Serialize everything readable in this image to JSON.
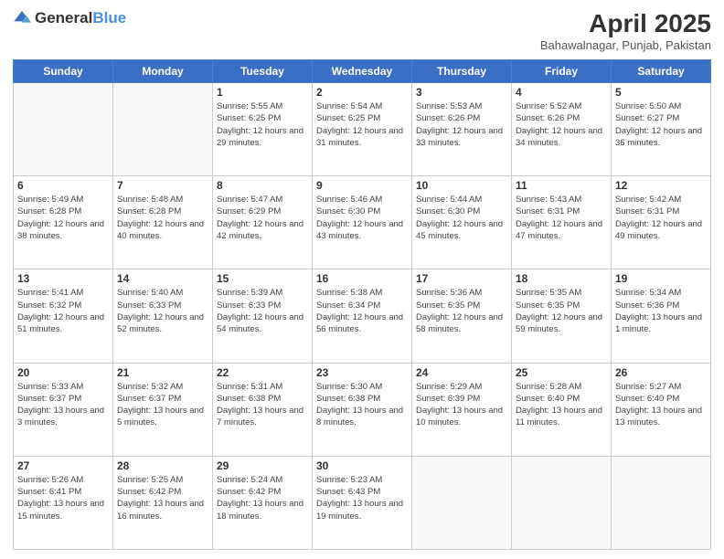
{
  "header": {
    "logo_general": "General",
    "logo_blue": "Blue",
    "title": "April 2025",
    "location": "Bahawalnagar, Punjab, Pakistan"
  },
  "days_of_week": [
    "Sunday",
    "Monday",
    "Tuesday",
    "Wednesday",
    "Thursday",
    "Friday",
    "Saturday"
  ],
  "weeks": [
    [
      {
        "day": "",
        "info": ""
      },
      {
        "day": "",
        "info": ""
      },
      {
        "day": "1",
        "info": "Sunrise: 5:55 AM\nSunset: 6:25 PM\nDaylight: 12 hours and 29 minutes."
      },
      {
        "day": "2",
        "info": "Sunrise: 5:54 AM\nSunset: 6:25 PM\nDaylight: 12 hours and 31 minutes."
      },
      {
        "day": "3",
        "info": "Sunrise: 5:53 AM\nSunset: 6:26 PM\nDaylight: 12 hours and 33 minutes."
      },
      {
        "day": "4",
        "info": "Sunrise: 5:52 AM\nSunset: 6:26 PM\nDaylight: 12 hours and 34 minutes."
      },
      {
        "day": "5",
        "info": "Sunrise: 5:50 AM\nSunset: 6:27 PM\nDaylight: 12 hours and 36 minutes."
      }
    ],
    [
      {
        "day": "6",
        "info": "Sunrise: 5:49 AM\nSunset: 6:28 PM\nDaylight: 12 hours and 38 minutes."
      },
      {
        "day": "7",
        "info": "Sunrise: 5:48 AM\nSunset: 6:28 PM\nDaylight: 12 hours and 40 minutes."
      },
      {
        "day": "8",
        "info": "Sunrise: 5:47 AM\nSunset: 6:29 PM\nDaylight: 12 hours and 42 minutes."
      },
      {
        "day": "9",
        "info": "Sunrise: 5:46 AM\nSunset: 6:30 PM\nDaylight: 12 hours and 43 minutes."
      },
      {
        "day": "10",
        "info": "Sunrise: 5:44 AM\nSunset: 6:30 PM\nDaylight: 12 hours and 45 minutes."
      },
      {
        "day": "11",
        "info": "Sunrise: 5:43 AM\nSunset: 6:31 PM\nDaylight: 12 hours and 47 minutes."
      },
      {
        "day": "12",
        "info": "Sunrise: 5:42 AM\nSunset: 6:31 PM\nDaylight: 12 hours and 49 minutes."
      }
    ],
    [
      {
        "day": "13",
        "info": "Sunrise: 5:41 AM\nSunset: 6:32 PM\nDaylight: 12 hours and 51 minutes."
      },
      {
        "day": "14",
        "info": "Sunrise: 5:40 AM\nSunset: 6:33 PM\nDaylight: 12 hours and 52 minutes."
      },
      {
        "day": "15",
        "info": "Sunrise: 5:39 AM\nSunset: 6:33 PM\nDaylight: 12 hours and 54 minutes."
      },
      {
        "day": "16",
        "info": "Sunrise: 5:38 AM\nSunset: 6:34 PM\nDaylight: 12 hours and 56 minutes."
      },
      {
        "day": "17",
        "info": "Sunrise: 5:36 AM\nSunset: 6:35 PM\nDaylight: 12 hours and 58 minutes."
      },
      {
        "day": "18",
        "info": "Sunrise: 5:35 AM\nSunset: 6:35 PM\nDaylight: 12 hours and 59 minutes."
      },
      {
        "day": "19",
        "info": "Sunrise: 5:34 AM\nSunset: 6:36 PM\nDaylight: 13 hours and 1 minute."
      }
    ],
    [
      {
        "day": "20",
        "info": "Sunrise: 5:33 AM\nSunset: 6:37 PM\nDaylight: 13 hours and 3 minutes."
      },
      {
        "day": "21",
        "info": "Sunrise: 5:32 AM\nSunset: 6:37 PM\nDaylight: 13 hours and 5 minutes."
      },
      {
        "day": "22",
        "info": "Sunrise: 5:31 AM\nSunset: 6:38 PM\nDaylight: 13 hours and 7 minutes."
      },
      {
        "day": "23",
        "info": "Sunrise: 5:30 AM\nSunset: 6:38 PM\nDaylight: 13 hours and 8 minutes."
      },
      {
        "day": "24",
        "info": "Sunrise: 5:29 AM\nSunset: 6:39 PM\nDaylight: 13 hours and 10 minutes."
      },
      {
        "day": "25",
        "info": "Sunrise: 5:28 AM\nSunset: 6:40 PM\nDaylight: 13 hours and 11 minutes."
      },
      {
        "day": "26",
        "info": "Sunrise: 5:27 AM\nSunset: 6:40 PM\nDaylight: 13 hours and 13 minutes."
      }
    ],
    [
      {
        "day": "27",
        "info": "Sunrise: 5:26 AM\nSunset: 6:41 PM\nDaylight: 13 hours and 15 minutes."
      },
      {
        "day": "28",
        "info": "Sunrise: 5:25 AM\nSunset: 6:42 PM\nDaylight: 13 hours and 16 minutes."
      },
      {
        "day": "29",
        "info": "Sunrise: 5:24 AM\nSunset: 6:42 PM\nDaylight: 13 hours and 18 minutes."
      },
      {
        "day": "30",
        "info": "Sunrise: 5:23 AM\nSunset: 6:43 PM\nDaylight: 13 hours and 19 minutes."
      },
      {
        "day": "",
        "info": ""
      },
      {
        "day": "",
        "info": ""
      },
      {
        "day": "",
        "info": ""
      }
    ]
  ]
}
